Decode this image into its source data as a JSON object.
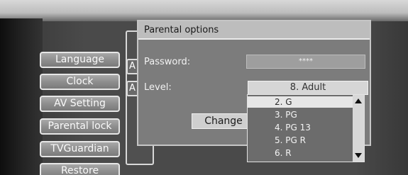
{
  "menu": {
    "items": [
      {
        "label": "Language"
      },
      {
        "label": "Clock"
      },
      {
        "label": "AV Setting"
      },
      {
        "label": "Parental lock"
      },
      {
        "label": "TVGuardian"
      },
      {
        "label": "Restore"
      }
    ]
  },
  "background_panel": {
    "box_1": "A",
    "box_2": "A"
  },
  "dialog": {
    "title": "Parental options",
    "password_label": "Password:",
    "password_value": "****",
    "level_label": "Level:",
    "level_value": "8. Adult",
    "change_label": "Change"
  },
  "dropdown": {
    "items": [
      {
        "label": "2. G",
        "selected": true
      },
      {
        "label": "3. PG"
      },
      {
        "label": "4. PG 13"
      },
      {
        "label": "5. PG R"
      },
      {
        "label": "6. R"
      }
    ],
    "scroll_up_icon": "triangle-up",
    "scroll_down_icon": "triangle-down"
  }
}
